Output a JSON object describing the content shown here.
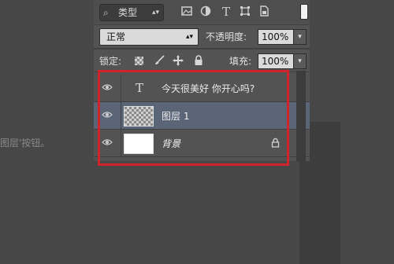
{
  "background": {
    "caption_fragment": "图层'按钮。"
  },
  "filter": {
    "label": "类型",
    "icons": [
      "image-filter-icon",
      "adjustment-filter-icon",
      "type-filter-icon",
      "shape-filter-icon",
      "smart-object-filter-icon"
    ],
    "t_glyph": "T"
  },
  "blend": {
    "mode": "正常",
    "opacity_label": "不透明度:",
    "opacity_value": "100%"
  },
  "lock": {
    "label": "锁定:",
    "fill_label": "填充:",
    "fill_value": "100%"
  },
  "layers": [
    {
      "name": "今天很美好 你开心吗?",
      "type": "text",
      "t_glyph": "T",
      "visible": true,
      "selected": false
    },
    {
      "name": "图层 1",
      "type": "transparent",
      "visible": true,
      "selected": true
    },
    {
      "name": "背景",
      "type": "background",
      "visible": true,
      "selected": false,
      "locked": true
    }
  ],
  "colors": {
    "panel": "#535353",
    "selected_layer": "#5a6578",
    "highlight_border": "#d0232a"
  }
}
